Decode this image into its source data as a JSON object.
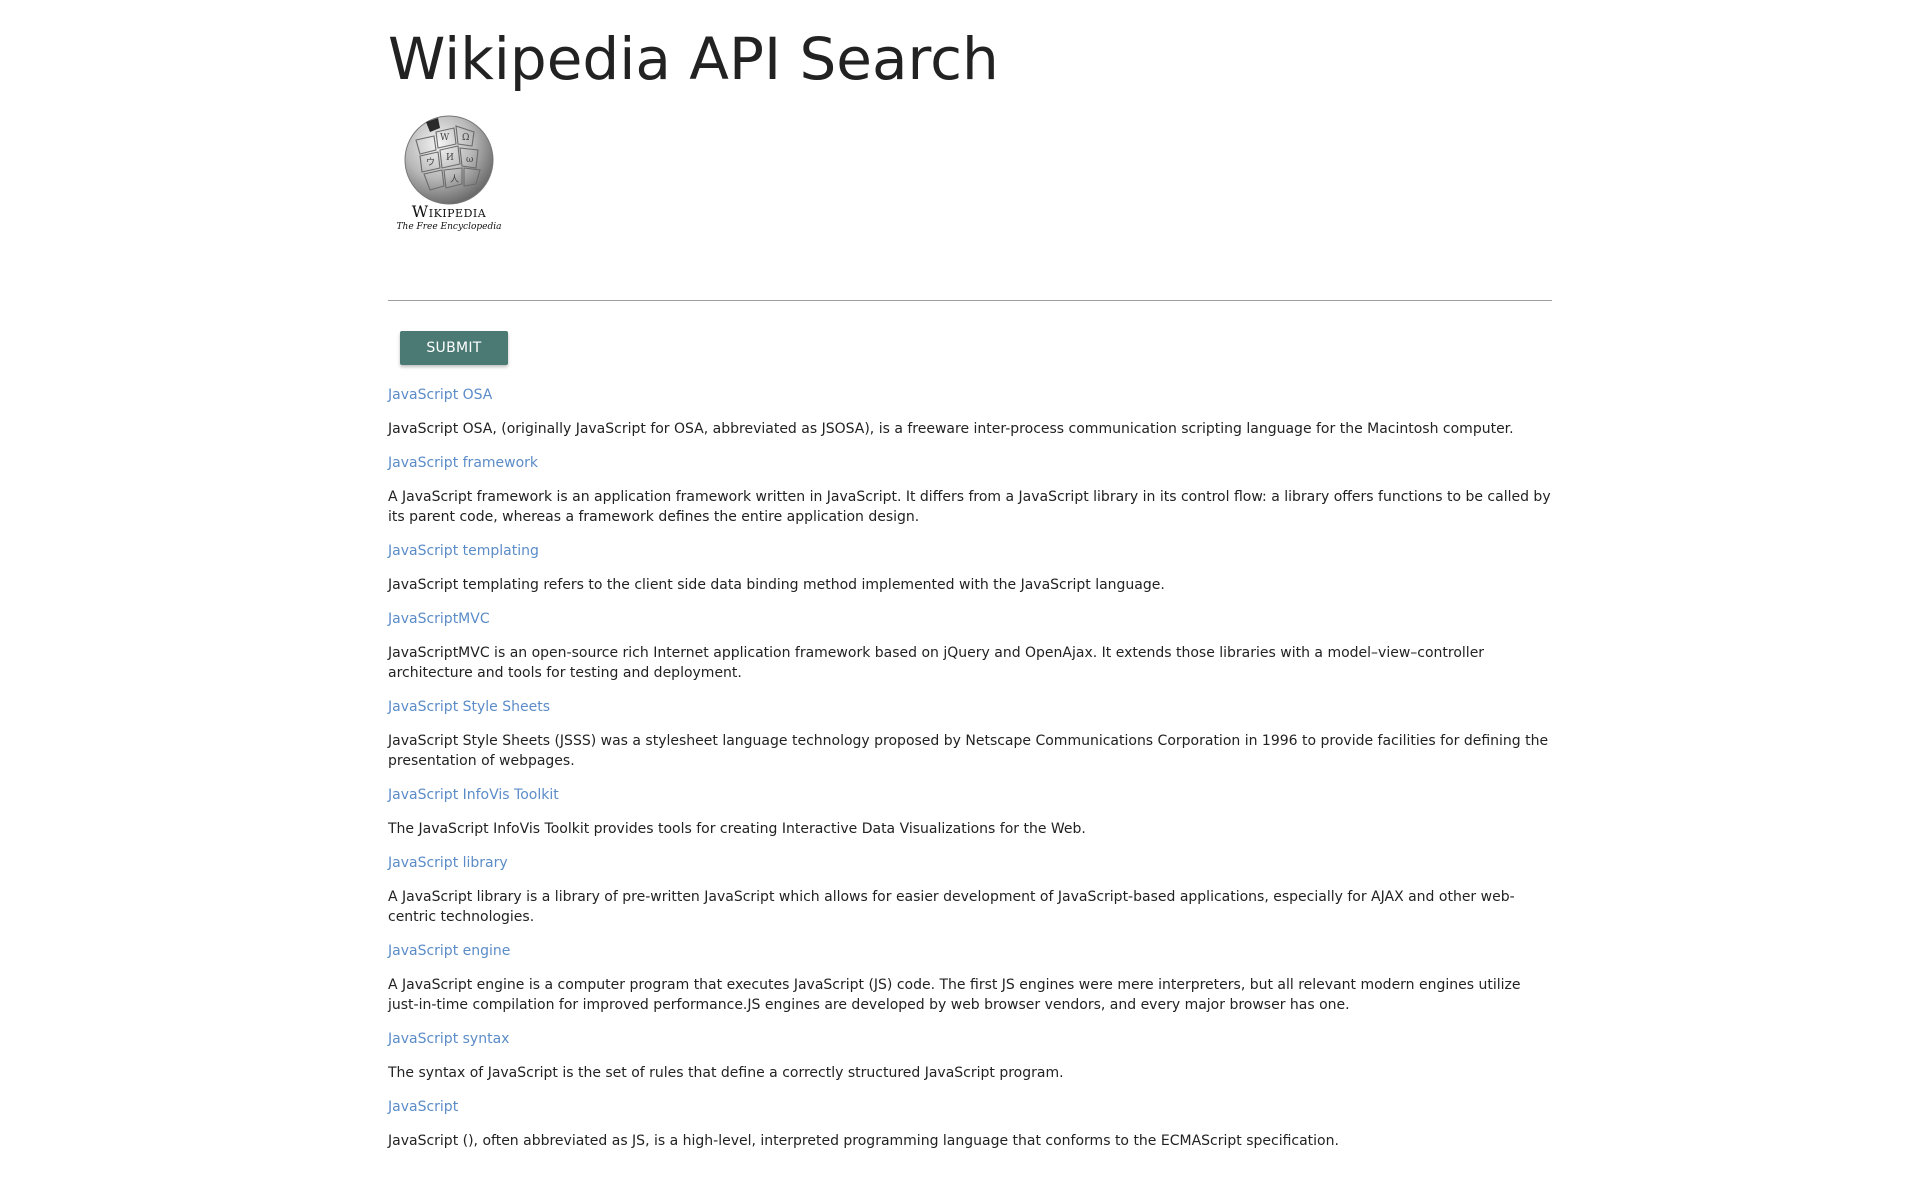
{
  "header": {
    "title": "Wikipedia API Search"
  },
  "logo": {
    "wordmark": "Wikipedia",
    "tagline": "The Free Encyclopedia"
  },
  "search": {
    "value": "",
    "placeholder": ""
  },
  "actions": {
    "submit_label": "SUBMIT"
  },
  "colors": {
    "link": "#5b8cc8",
    "button": "#4a7a73",
    "text": "#222222"
  },
  "results": [
    {
      "title": "JavaScript OSA",
      "snippet": "JavaScript OSA, (originally JavaScript for OSA, abbreviated as JSOSA), is a freeware inter-process communication scripting language for the Macintosh computer."
    },
    {
      "title": "JavaScript framework",
      "snippet": "A JavaScript framework is an application framework written in JavaScript. It differs from a JavaScript library in its control flow: a library offers functions to be called by its parent code, whereas a framework defines the entire application design."
    },
    {
      "title": "JavaScript templating",
      "snippet": "JavaScript templating refers to the client side data binding method implemented with the JavaScript language."
    },
    {
      "title": "JavaScriptMVC",
      "snippet": "JavaScriptMVC is an open-source rich Internet application framework based on jQuery and OpenAjax. It extends those libraries with a model–view–controller architecture and tools for testing and deployment."
    },
    {
      "title": "JavaScript Style Sheets",
      "snippet": "JavaScript Style Sheets (JSSS) was a stylesheet language technology proposed by Netscape Communications Corporation in 1996 to provide facilities for defining the presentation of webpages."
    },
    {
      "title": "JavaScript InfoVis Toolkit",
      "snippet": "The JavaScript InfoVis Toolkit provides tools for creating Interactive Data Visualizations for the Web."
    },
    {
      "title": "JavaScript library",
      "snippet": "A JavaScript library is a library of pre-written JavaScript which allows for easier development of JavaScript-based applications, especially for AJAX and other web-centric technologies."
    },
    {
      "title": "JavaScript engine",
      "snippet": "A JavaScript engine is a computer program that executes JavaScript (JS) code. The first JS engines were mere interpreters, but all relevant modern engines utilize just-in-time compilation for improved performance.JS engines are developed by web browser vendors, and every major browser has one."
    },
    {
      "title": "JavaScript syntax",
      "snippet": "The syntax of JavaScript is the set of rules that define a correctly structured JavaScript program."
    },
    {
      "title": "JavaScript",
      "snippet": "JavaScript (), often abbreviated as JS, is a high-level, interpreted programming language that conforms to the ECMAScript specification."
    }
  ]
}
